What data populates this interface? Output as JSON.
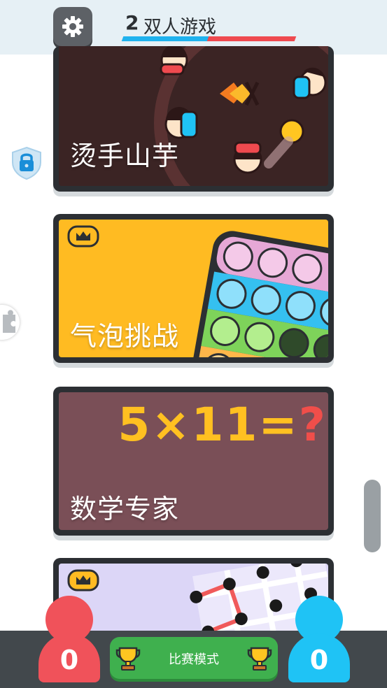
{
  "header": {
    "title_number": "2",
    "title": "双人游戏",
    "accent_blue": "#1fb2ee",
    "accent_red": "#ef4a4f"
  },
  "games": [
    {
      "title": "烫手山芋",
      "locked": true,
      "premium": false
    },
    {
      "title": "气泡挑战",
      "locked": false,
      "premium": true
    },
    {
      "title": "数学专家",
      "locked": false,
      "premium": false,
      "art_text": {
        "expression": "5×11=",
        "question": "?"
      }
    },
    {
      "title": "",
      "locked": false,
      "premium": true
    }
  ],
  "bottom_bar": {
    "red_score": "0",
    "blue_score": "0",
    "tournament_label": "比赛模式"
  },
  "icons": [
    "gear-icon",
    "lock-icon",
    "crown-icon",
    "trophy-icon",
    "puzzle-icon"
  ]
}
